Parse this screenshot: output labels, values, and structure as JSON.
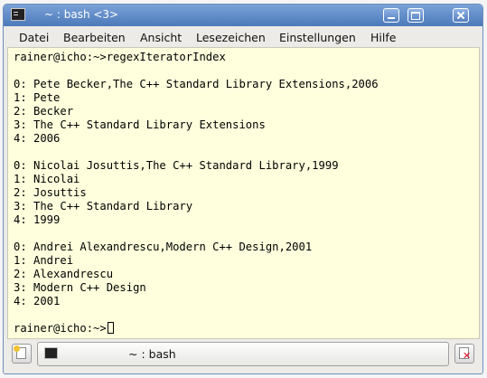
{
  "window": {
    "title": "~ : bash <3>"
  },
  "menu": {
    "items": [
      "Datei",
      "Bearbeiten",
      "Ansicht",
      "Lesezeichen",
      "Einstellungen",
      "Hilfe"
    ]
  },
  "terminal": {
    "lines": [
      "rainer@icho:~>regexIteratorIndex",
      "",
      "0: Pete Becker,The C++ Standard Library Extensions,2006",
      "1: Pete",
      "2: Becker",
      "3: The C++ Standard Library Extensions",
      "4: 2006",
      "",
      "0: Nicolai Josuttis,The C++ Standard Library,1999",
      "1: Nicolai",
      "2: Josuttis",
      "3: The C++ Standard Library",
      "4: 1999",
      "",
      "0: Andrei Alexandrescu,Modern C++ Design,2001",
      "1: Andrei",
      "2: Alexandrescu",
      "3: Modern C++ Design",
      "4: 2001",
      "",
      "rainer@icho:~>"
    ]
  },
  "tabs": {
    "active_label": "~ : bash"
  },
  "icons": {
    "app": "terminal-icon",
    "new_tab": "new-tab-icon",
    "close_tab": "close-tab-icon"
  },
  "colors": {
    "titlebar": "#5a86c5",
    "terminal_background": "#ffffdd"
  }
}
